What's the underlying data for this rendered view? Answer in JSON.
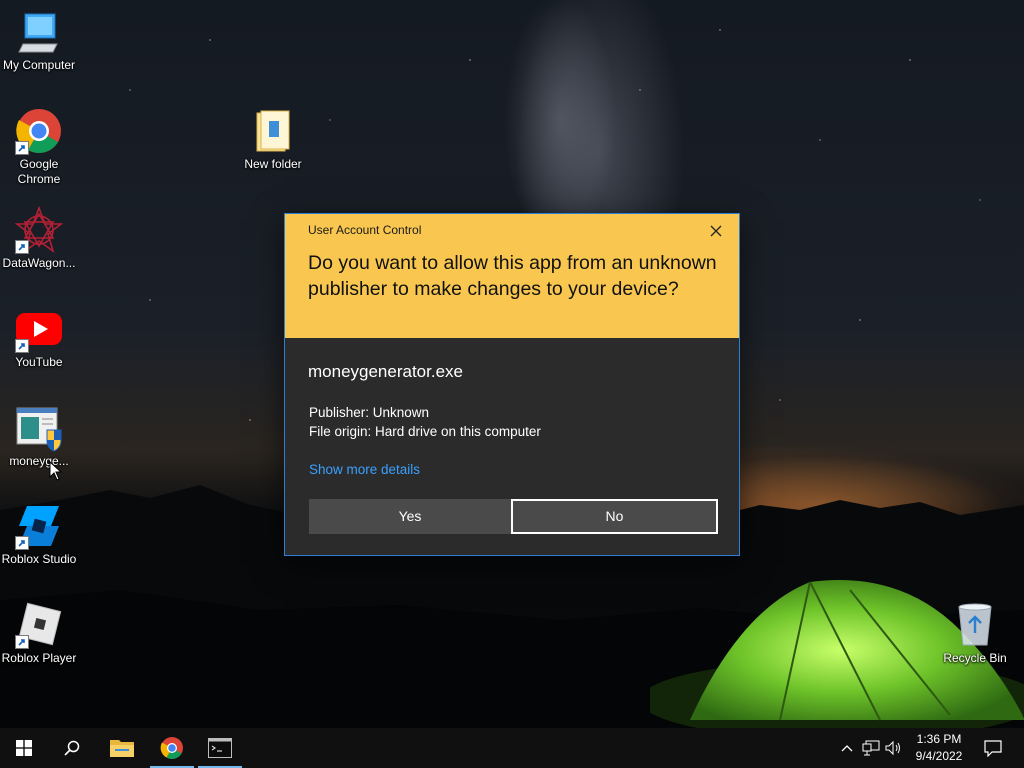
{
  "desktop": {
    "icons": [
      {
        "label": "My Computer",
        "icon": "computer-icon"
      },
      {
        "label": "Google Chrome",
        "icon": "chrome-icon"
      },
      {
        "label": "DataWagon...",
        "icon": "datawagon-icon"
      },
      {
        "label": "YouTube",
        "icon": "youtube-icon"
      },
      {
        "label": "moneyge...",
        "icon": "installer-icon"
      },
      {
        "label": "Roblox Studio",
        "icon": "roblox-studio-icon"
      },
      {
        "label": "Roblox Player",
        "icon": "roblox-player-icon"
      },
      {
        "label": "New folder",
        "icon": "folder-icon"
      },
      {
        "label": "Recycle Bin",
        "icon": "recycle-bin-icon"
      }
    ]
  },
  "uac": {
    "caption": "User Account Control",
    "question": "Do you want to allow this app from an unknown publisher to make changes to your device?",
    "app_name": "moneygenerator.exe",
    "publisher": "Publisher: Unknown",
    "file_origin": "File origin: Hard drive on this computer",
    "more_details": "Show more details",
    "yes_label": "Yes",
    "no_label": "No",
    "header_color": "#f9c74f",
    "body_color": "#2b2b2b",
    "accent_link": "#3aa0ff"
  },
  "taskbar": {
    "time": "1:36 PM",
    "date": "9/4/2022",
    "pinned": [
      "start-icon",
      "search-icon",
      "file-explorer-icon",
      "chrome-icon",
      "terminal-icon"
    ],
    "tray": [
      "chevron-up-icon",
      "network-icon",
      "volume-icon",
      "notification-icon"
    ]
  }
}
